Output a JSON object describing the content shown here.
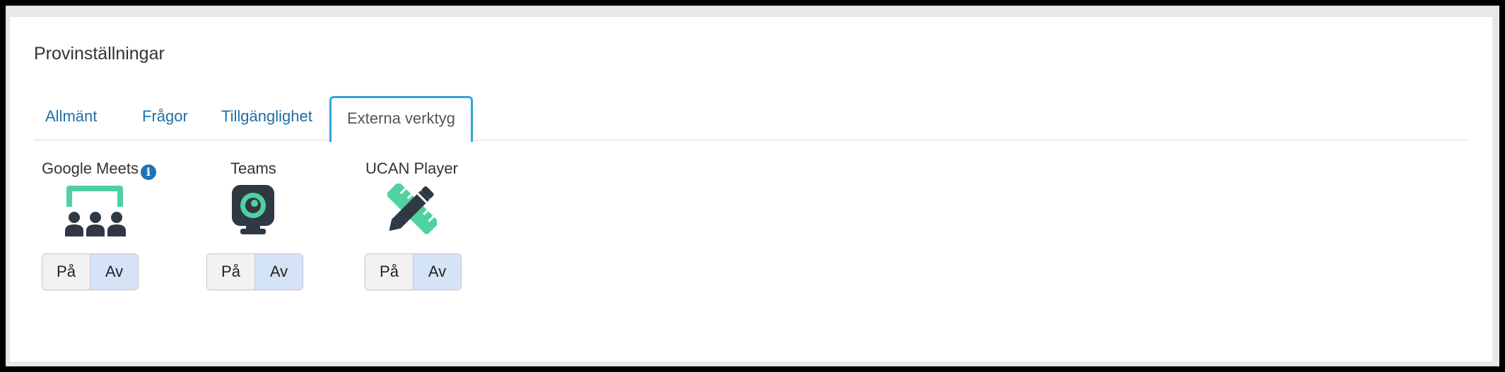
{
  "page": {
    "title": "Provinställningar"
  },
  "tabs": [
    {
      "label": "Allmänt",
      "active": false
    },
    {
      "label": "Frågor",
      "active": false
    },
    {
      "label": "Tillgänglighet",
      "active": false
    },
    {
      "label": "Externa verktyg",
      "active": true
    }
  ],
  "tools": [
    {
      "name": "Google Meets",
      "has_info": true,
      "icon": "meeting-group-icon",
      "on_label": "På",
      "off_label": "Av",
      "selected": "Av"
    },
    {
      "name": "Teams",
      "has_info": false,
      "icon": "webcam-icon",
      "on_label": "På",
      "off_label": "Av",
      "selected": "Av"
    },
    {
      "name": "UCAN Player",
      "has_info": false,
      "icon": "pencil-ruler-icon",
      "on_label": "På",
      "off_label": "Av",
      "selected": "Av"
    }
  ],
  "colors": {
    "accent": "#31a2df",
    "link": "#1e6fa8",
    "icon_dark": "#2f3943",
    "icon_green": "#4fd1a0",
    "selected_toggle": "#d5e3f7"
  }
}
